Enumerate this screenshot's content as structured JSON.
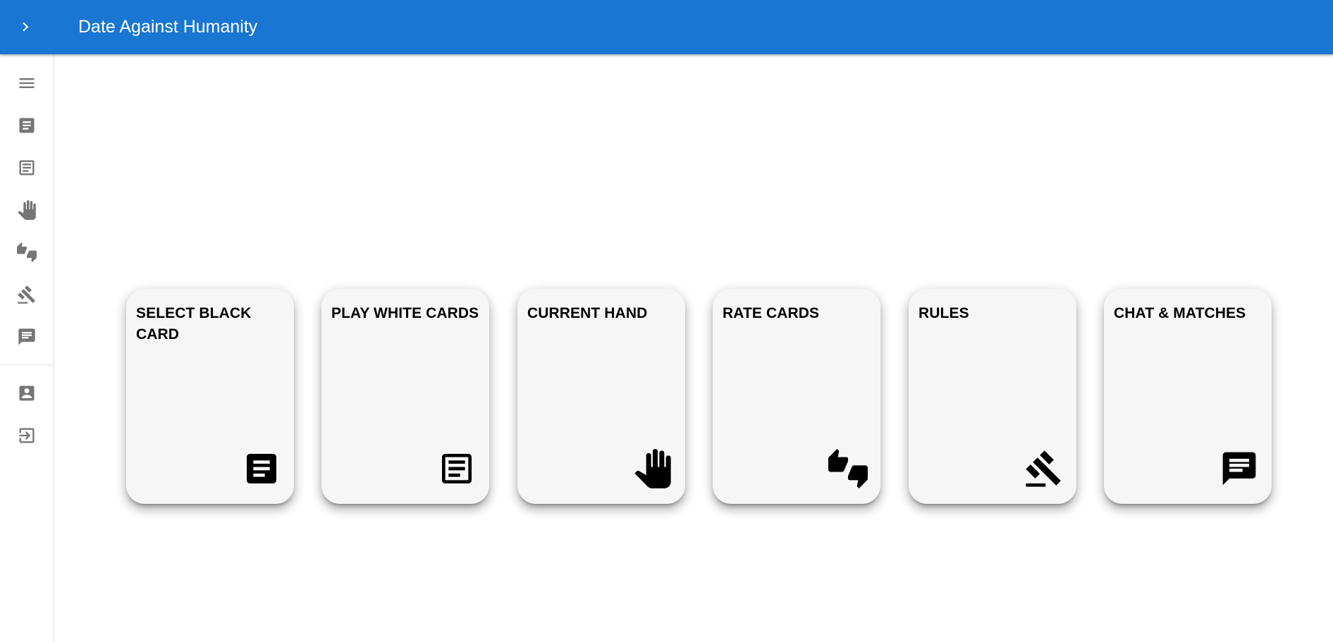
{
  "app": {
    "title": "Date Against Humanity",
    "accent_color": "#1976d2",
    "toggle_icon": "chevron-right-icon"
  },
  "sidebar": {
    "items": [
      {
        "name": "menu",
        "icon": "menu-icon"
      },
      {
        "name": "select-black-card",
        "icon": "article-filled-icon"
      },
      {
        "name": "play-white-cards",
        "icon": "article-outline-icon"
      },
      {
        "name": "current-hand",
        "icon": "hand-icon"
      },
      {
        "name": "rate-cards",
        "icon": "thumbs-up-down-icon"
      },
      {
        "name": "rules",
        "icon": "gavel-icon"
      },
      {
        "name": "chat-matches",
        "icon": "chat-icon"
      },
      {
        "name": "profile",
        "icon": "account-box-icon"
      },
      {
        "name": "logout",
        "icon": "logout-icon"
      }
    ]
  },
  "cards": [
    {
      "label": "SELECT BLACK CARD",
      "icon": "article-filled-icon"
    },
    {
      "label": "PLAY WHITE CARDS",
      "icon": "article-outline-icon"
    },
    {
      "label": "CURRENT HAND",
      "icon": "hand-icon"
    },
    {
      "label": "RATE CARDS",
      "icon": "thumbs-up-down-icon"
    },
    {
      "label": "RULES",
      "icon": "gavel-icon"
    },
    {
      "label": "CHAT & MATCHES",
      "icon": "chat-icon"
    }
  ]
}
